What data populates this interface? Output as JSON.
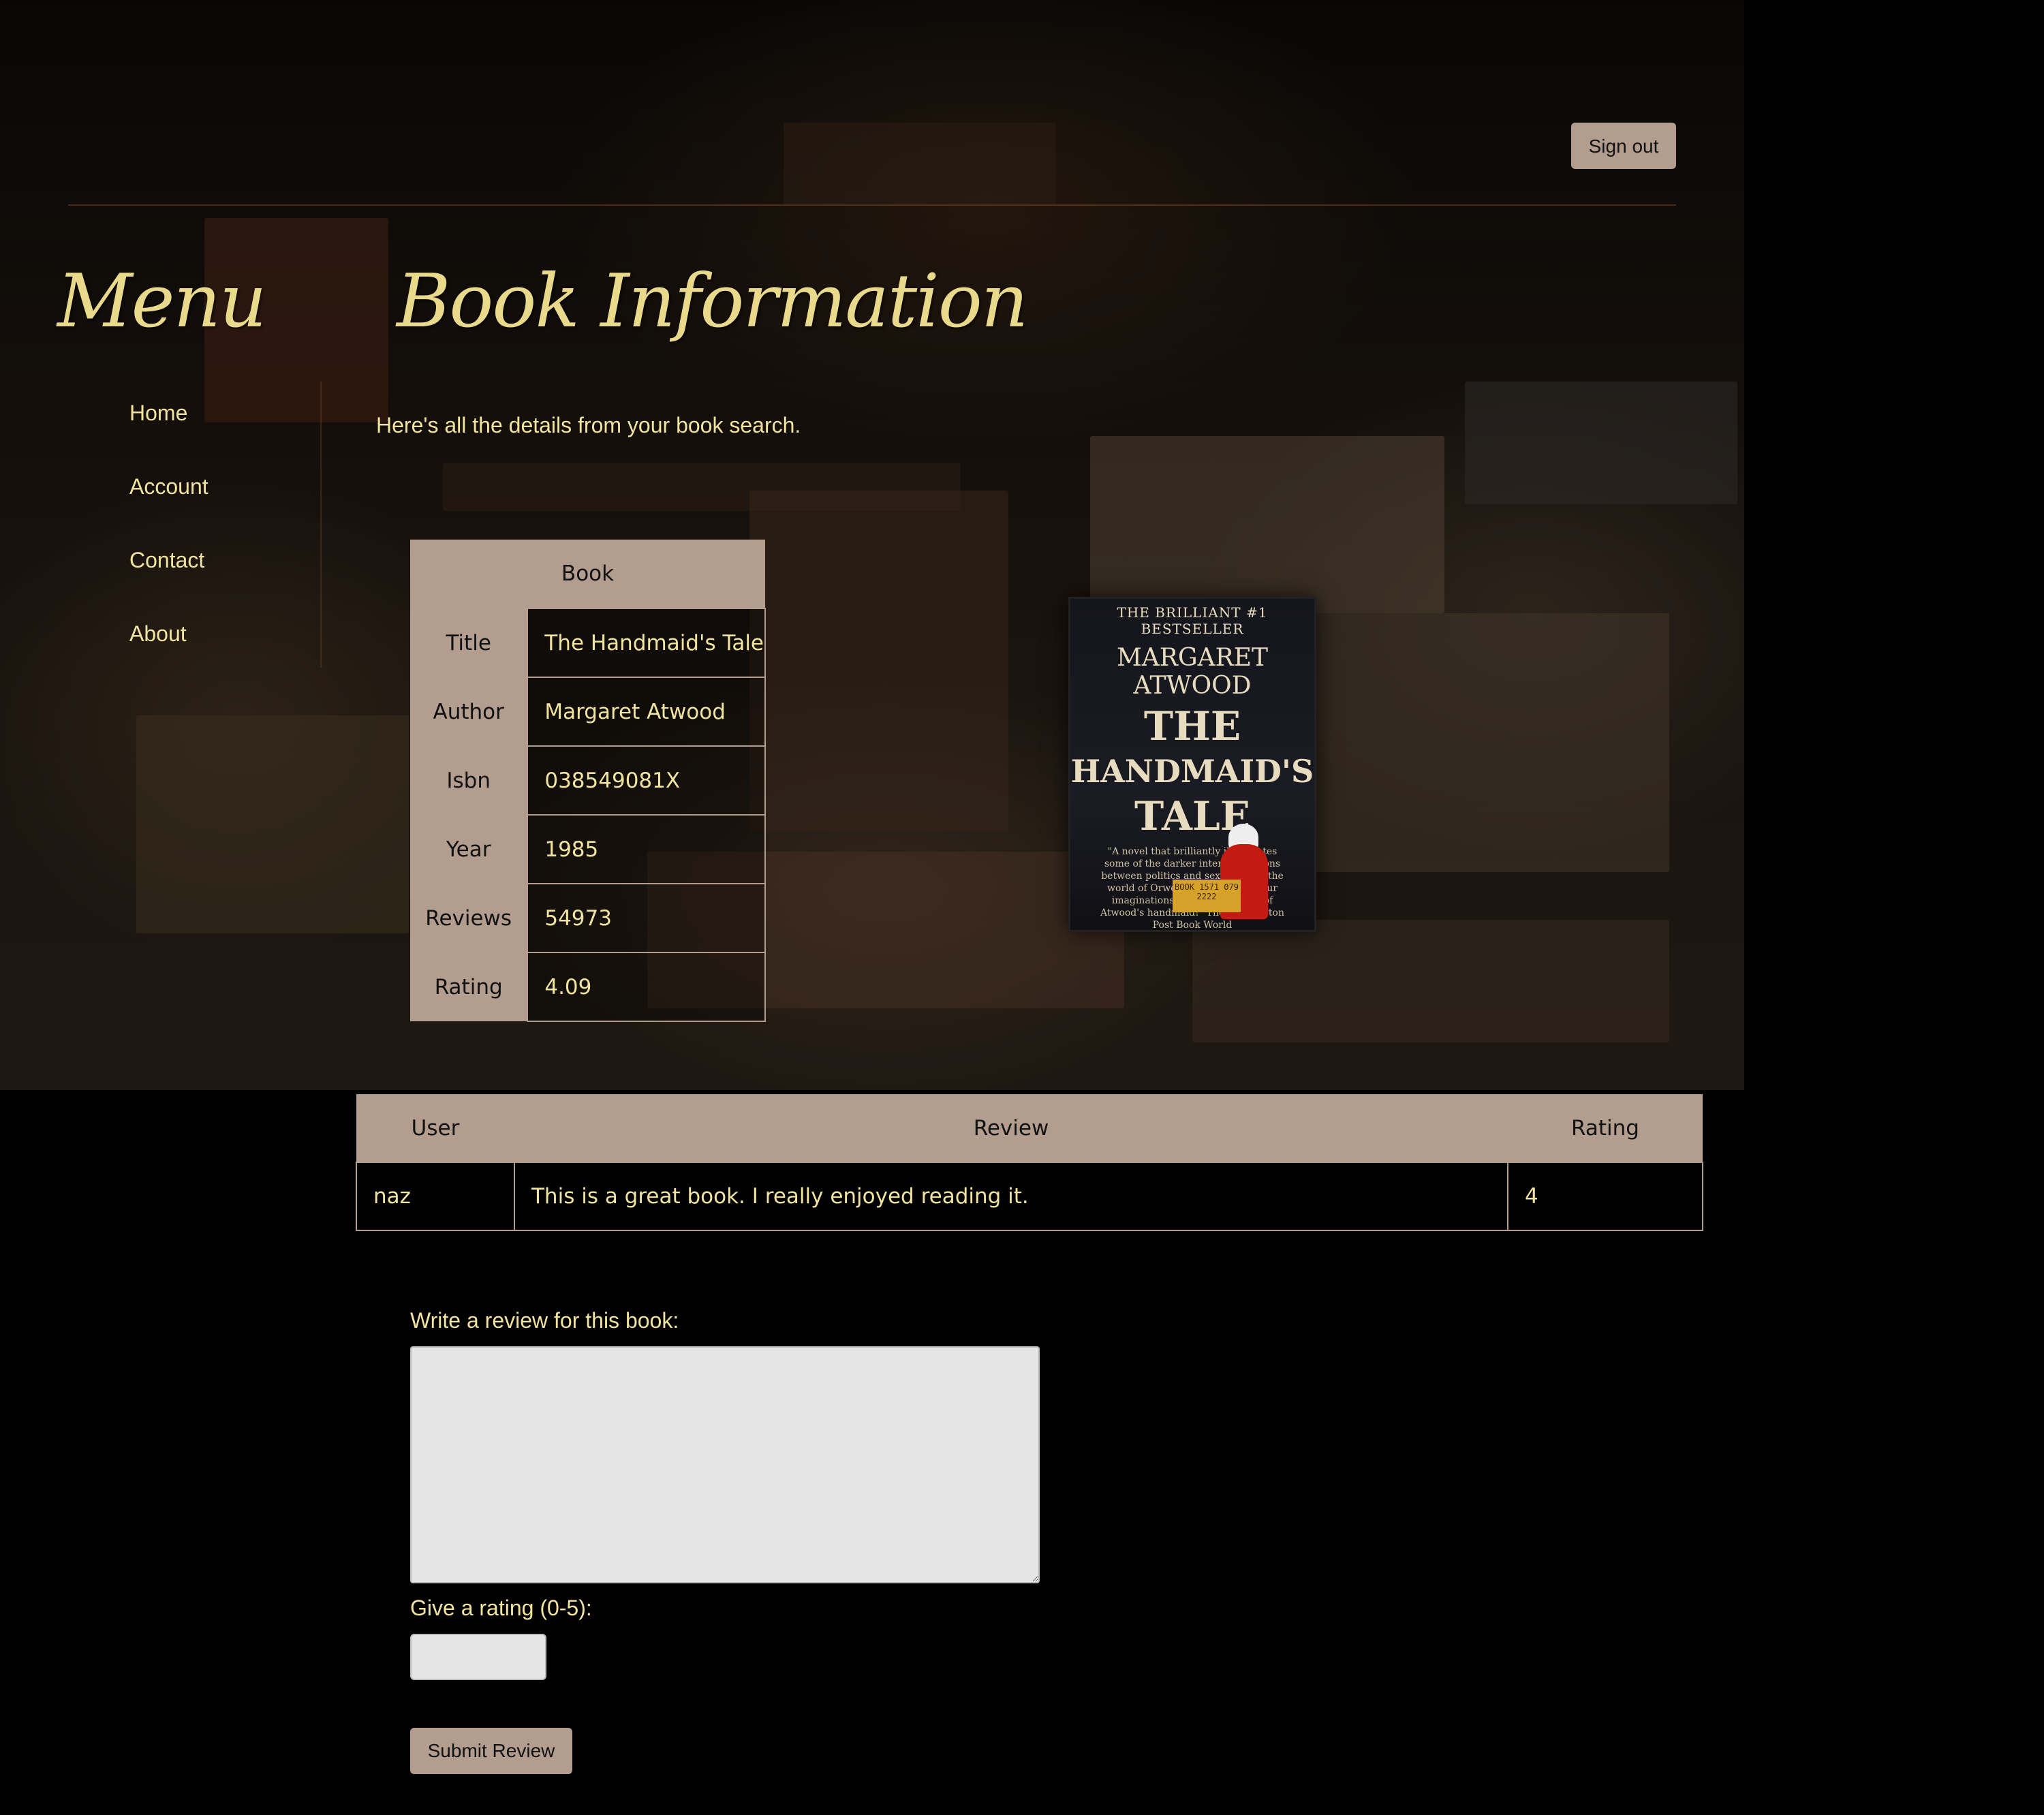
{
  "header": {
    "sign_out_label": "Sign out"
  },
  "menu": {
    "title": "Menu",
    "items": [
      {
        "label": "Home"
      },
      {
        "label": "Account"
      },
      {
        "label": "Contact"
      },
      {
        "label": "About"
      }
    ]
  },
  "main": {
    "title": "Book Information",
    "intro": "Here's all the details from your book search."
  },
  "book": {
    "header": "Book",
    "fields": [
      {
        "key": "Title",
        "value": "The Handmaid's Tale"
      },
      {
        "key": "Author",
        "value": "Margaret Atwood"
      },
      {
        "key": "Isbn",
        "value": "038549081X"
      },
      {
        "key": "Year",
        "value": "1985"
      },
      {
        "key": "Reviews",
        "value": "54973"
      },
      {
        "key": "Rating",
        "value": "4.09"
      }
    ],
    "cover": {
      "tagline": "THE BRILLIANT #1 BESTSELLER",
      "author": "MARGARET ATWOOD",
      "title_line1": "THE",
      "title_line2": "HANDMAID'S",
      "title_line3": "TALE",
      "blurb": "\"A novel that brilliantly illuminates some of the darker interconnections between politics and sex... Just as the world of Orwell's 1984 gripped our imaginations, so will the world of Atwood's handmaid!\" The Washington Post Book World",
      "sticker": "BOOK 1571 079 2222"
    }
  },
  "reviews": {
    "columns": [
      "User",
      "Review",
      "Rating"
    ],
    "rows": [
      {
        "user": "naz",
        "review": "This is a great book. I really enjoyed reading it.",
        "rating": "4"
      }
    ]
  },
  "form": {
    "review_label": "Write a review for this book:",
    "review_value": "",
    "rating_label": "Give a rating (0-5):",
    "rating_value": "",
    "submit_label": "Submit Review"
  },
  "colors": {
    "accent_text": "#f1e3a0",
    "title_text": "#e9d98a",
    "button_bg": "#b39d8f",
    "page_bg": "#000000"
  }
}
